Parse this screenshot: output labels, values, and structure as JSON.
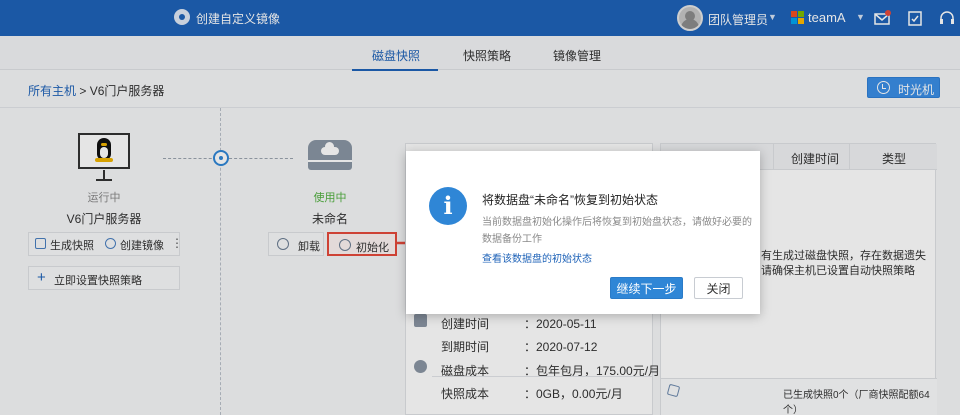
{
  "header": {
    "title": "创建自定义镜像",
    "user": "团队管理员",
    "team": "teamA"
  },
  "tabs": [
    {
      "label": "磁盘快照",
      "active": true
    },
    {
      "label": "快照策略",
      "active": false
    },
    {
      "label": "镜像管理",
      "active": false
    }
  ],
  "breadcrumb": {
    "root": "所有主机",
    "separator": ">",
    "current": "V6门户服务器"
  },
  "time_machine_label": "时光机",
  "server": {
    "status": "运行中",
    "name": "V6门户服务器",
    "snapshot_label": "生成快照",
    "image_label": "创建镜像",
    "more": "⋮",
    "strategy_label": "立即设置快照策略"
  },
  "disk": {
    "status": "使用中",
    "name": "未命名",
    "unmount_label": "卸载",
    "init_label": "初始化"
  },
  "info": {
    "created_label": "创建时间",
    "created_value": "：2020-05-11",
    "expire_label": "到期时间",
    "expire_value": "：2020-07-12",
    "disk_cost_label": "磁盘成本",
    "disk_cost_value": "：包年包月，175.00元/月",
    "snap_cost_label": "快照成本",
    "snap_cost_value": "：0GB，0.00元/月"
  },
  "snapshot_table": {
    "columns": [
      "创建时间",
      "类型"
    ],
    "empty_line1": "有生成过磁盘快照，存在数据遗失",
    "empty_line2": "请确保主机已设置自动快照策略",
    "footer_count": "已生成快照0个（厂商快照配额64个）"
  },
  "dialog": {
    "icon": "i",
    "title": "将数据盘“未命名”恢复到初始状态",
    "desc": "当前数据盘初始化操作后将恢复到初始盘状态，请做好必要的数据备份工作",
    "link": "查看该数据盘的初始状态",
    "primary": "继续下一步",
    "secondary": "关闭"
  },
  "colors": {
    "brand": "#1f63b8",
    "accent": "#2f86d6",
    "running": "#888888",
    "in_use": "#52b040",
    "highlight": "#e64a3b"
  },
  "icons": {
    "logo": "aperture-icon",
    "mail": "mail-icon",
    "tasks": "checklist-icon",
    "support": "headset-icon",
    "time_machine": "clock-icon",
    "info": "info-icon"
  }
}
